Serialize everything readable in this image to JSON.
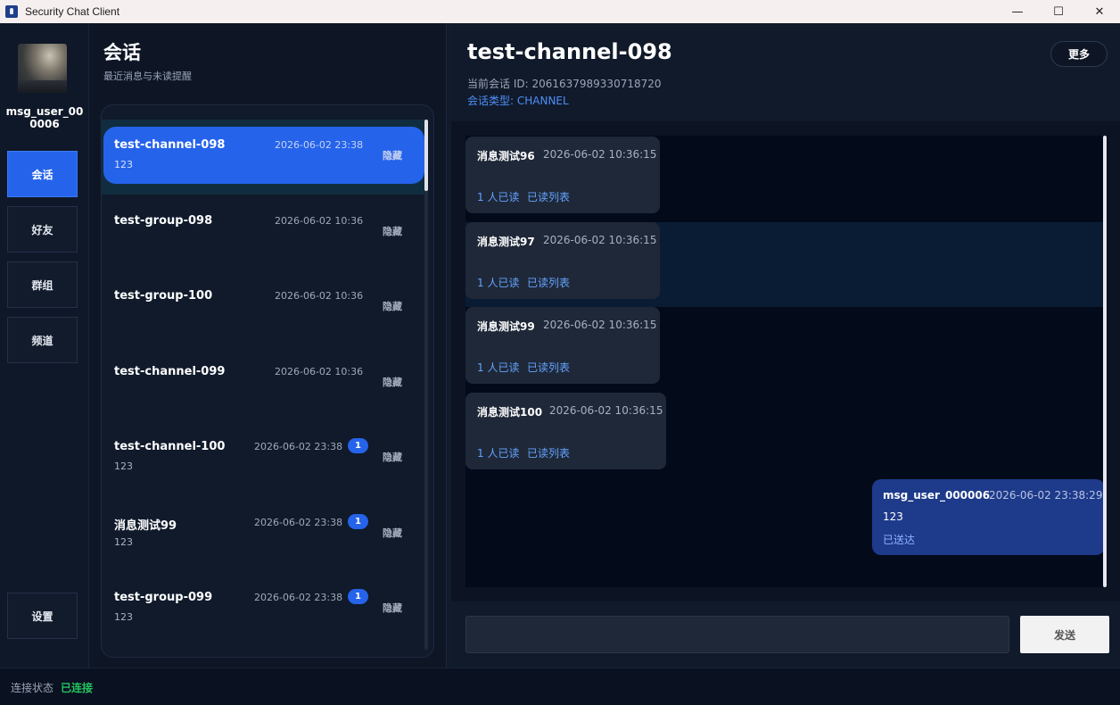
{
  "window": {
    "title": "Security Chat Client",
    "minimize": "—",
    "maximize": "☐",
    "close": "✕"
  },
  "user": {
    "name": "msg_user_000006"
  },
  "nav": {
    "conversations": "会话",
    "friends": "好友",
    "groups": "群组",
    "channels": "频道",
    "settings": "设置"
  },
  "conv_panel": {
    "title": "会话",
    "subtitle": "最近消息与未读提醒",
    "items": [
      {
        "name": "test-channel-098",
        "time": "2026-06-02 23:38",
        "preview": "123",
        "badge": "",
        "hide": "隐藏"
      },
      {
        "name": "test-group-098",
        "time": "2026-06-02 10:36",
        "preview": "",
        "badge": "",
        "hide": "隐藏"
      },
      {
        "name": "test-group-100",
        "time": "2026-06-02 10:36",
        "preview": "",
        "badge": "",
        "hide": "隐藏"
      },
      {
        "name": "test-channel-099",
        "time": "2026-06-02 10:36",
        "preview": "",
        "badge": "",
        "hide": "隐藏"
      },
      {
        "name": "test-channel-100",
        "time": "2026-06-02 23:38",
        "preview": "123",
        "badge": "1",
        "hide": "隐藏"
      },
      {
        "name": "消息测试99",
        "time": "2026-06-02 23:38",
        "preview": "123",
        "badge": "1",
        "hide": "隐藏"
      },
      {
        "name": "test-group-099",
        "time": "2026-06-02 23:38",
        "preview": "123",
        "badge": "1",
        "hide": "隐藏"
      }
    ]
  },
  "chat": {
    "title": "test-channel-098",
    "session_id": "当前会话 ID: 2061637989330718720",
    "session_type": "会话类型: CHANNEL",
    "more": "更多",
    "messages": [
      {
        "sender": "消息测试96",
        "time": "2026-06-02 10:36:15",
        "read": "1 人已读",
        "read_list": "已读列表"
      },
      {
        "sender": "消息测试97",
        "time": "2026-06-02 10:36:15",
        "read": "1 人已读",
        "read_list": "已读列表"
      },
      {
        "sender": "消息测试99",
        "time": "2026-06-02 10:36:15",
        "read": "1 人已读",
        "read_list": "已读列表"
      },
      {
        "sender": "消息测试100",
        "time": "2026-06-02 10:36:15",
        "read": "1 人已读",
        "read_list": "已读列表"
      }
    ],
    "my_message": {
      "sender": "msg_user_000006",
      "time": "2026-06-02 23:38:29",
      "body": "123",
      "status": "已送达"
    },
    "input_value": "",
    "send": "发送"
  },
  "status": {
    "label": "连接状态",
    "value": "已连接",
    "value_color": "#22c55e"
  },
  "colors": {
    "accent": "#2563eb",
    "background": "#0c1424",
    "link": "#63a3ff"
  }
}
